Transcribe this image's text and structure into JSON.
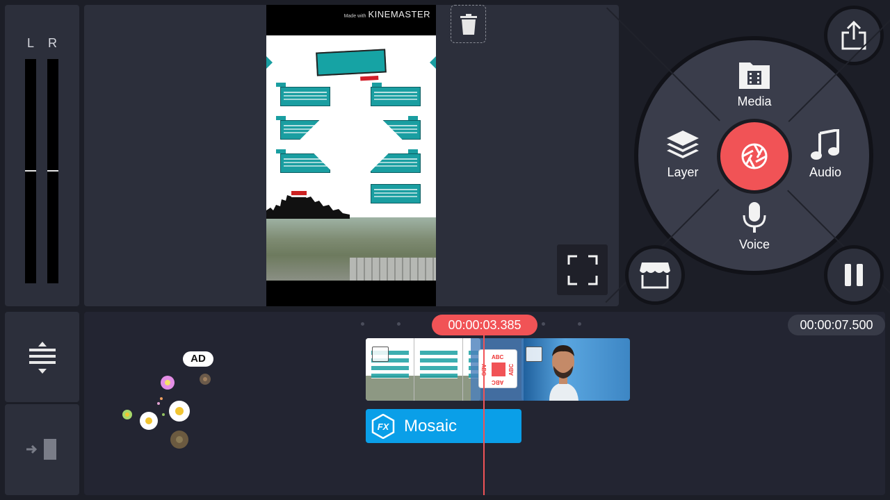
{
  "meter": {
    "left_label": "L",
    "right_label": "R"
  },
  "preview": {
    "watermark_prefix": "Made with",
    "watermark_brand": "KINEMASTER"
  },
  "wheel": {
    "media_label": "Media",
    "layer_label": "Layer",
    "audio_label": "Audio",
    "voice_label": "Voice"
  },
  "timeline": {
    "playhead_time": "00:00:03.385",
    "total_time": "00:00:07.500",
    "effect_clip_label": "Mosaic"
  },
  "ad": {
    "badge_label": "AD"
  },
  "transition": {
    "icon_text": "ABC"
  },
  "colors": {
    "accent_red": "#f15356",
    "fx_blue": "#0a9fe8",
    "panel": "#2c2f3b",
    "background": "#1c1e27"
  },
  "icons": [
    "delete-icon",
    "fullscreen-icon",
    "share-icon",
    "media-icon",
    "layer-icon",
    "audio-icon",
    "voice-icon",
    "camera-icon",
    "store-icon",
    "pause-icon",
    "split-icon",
    "export-frame-icon",
    "fx-icon",
    "image-clip-icon"
  ]
}
